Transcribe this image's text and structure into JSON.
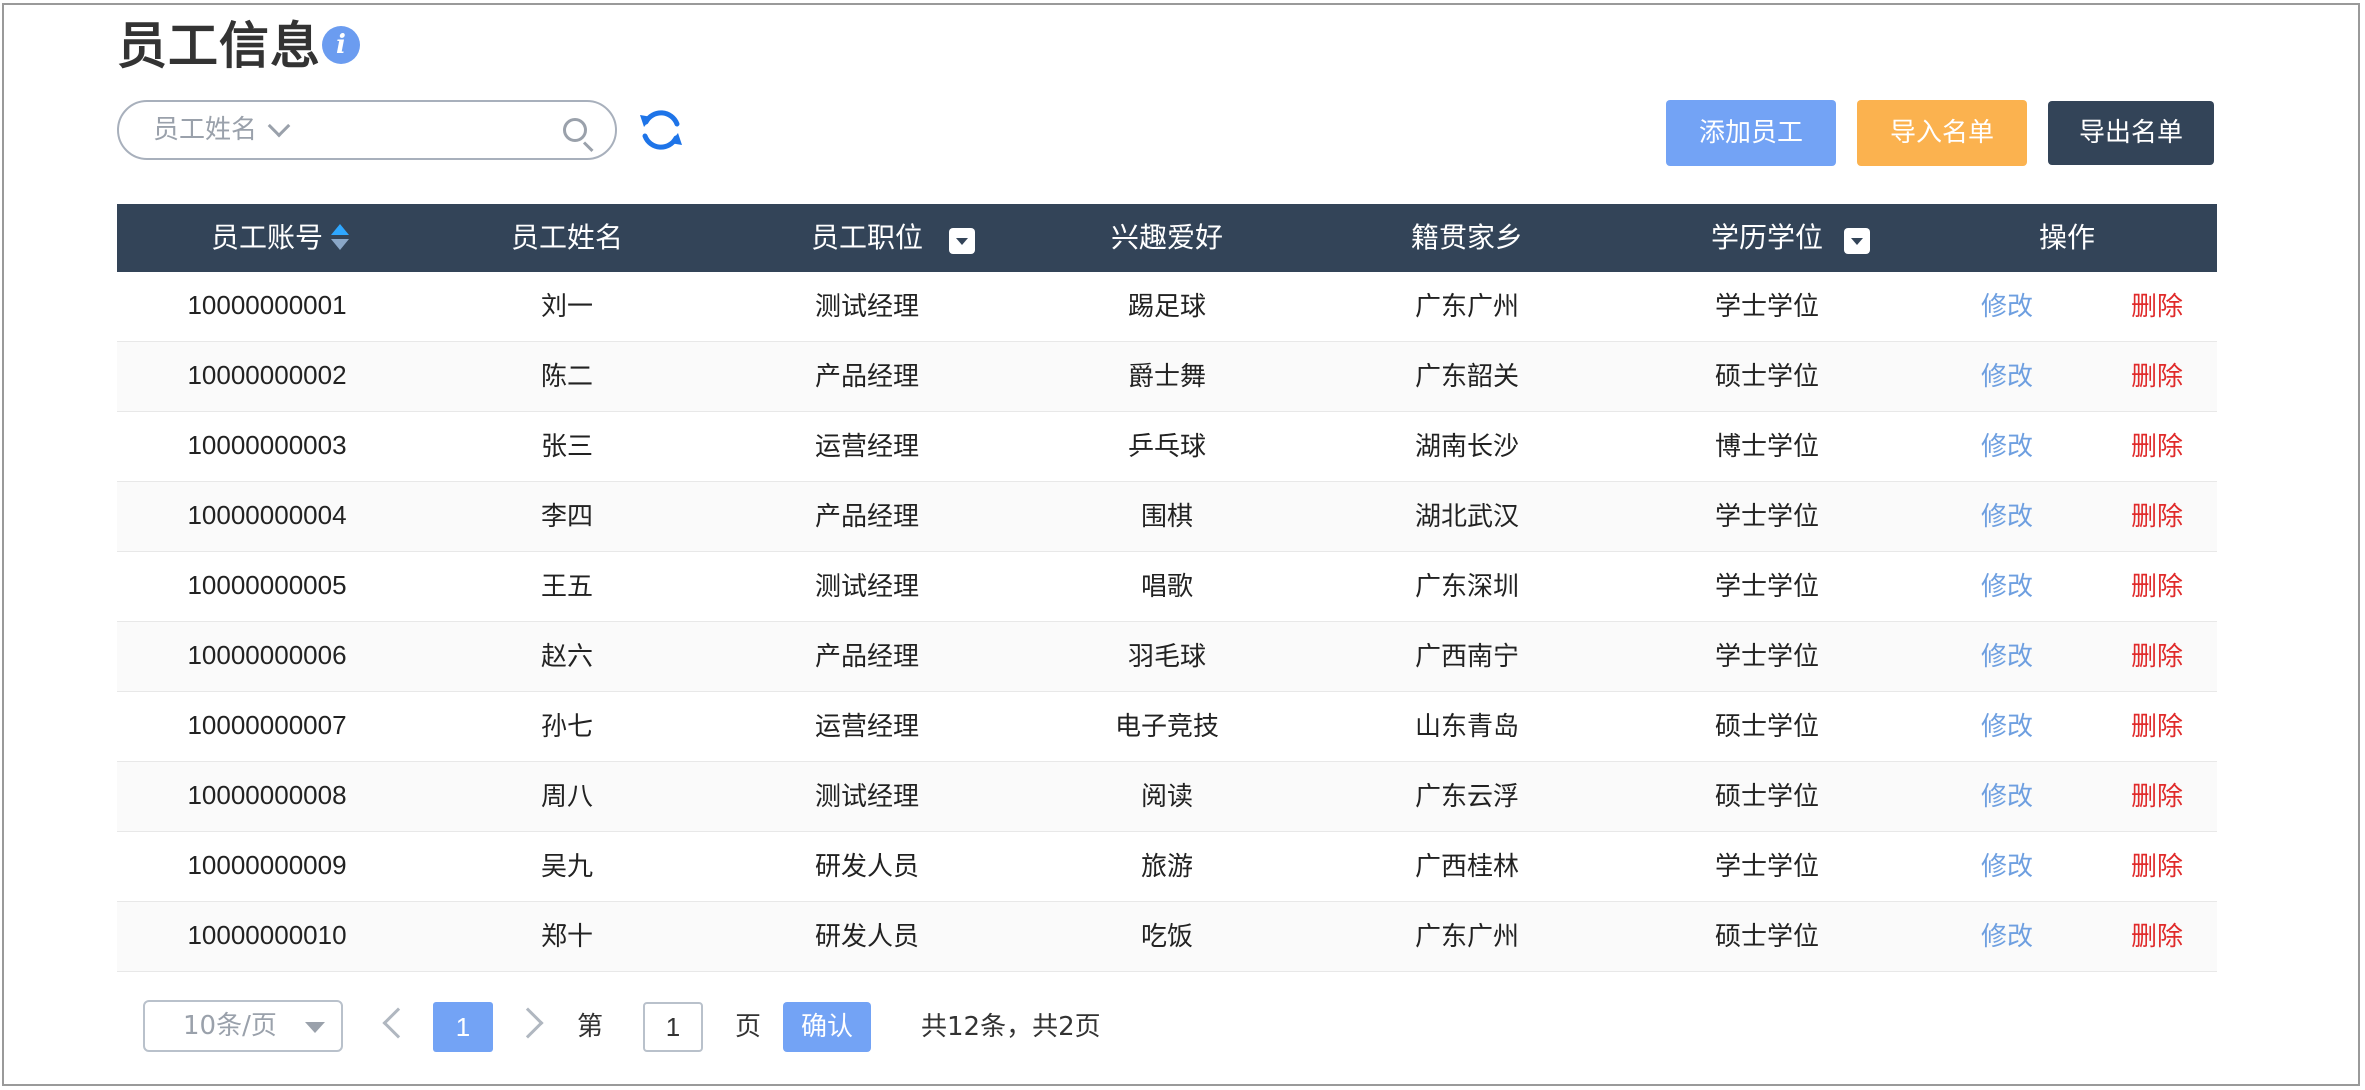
{
  "page": {
    "title": "员工信息",
    "info_icon": "info-icon"
  },
  "toolbar": {
    "search_field": "员工姓名",
    "search_placeholder": "",
    "search_icon": "search-icon",
    "refresh_icon": "refresh-icon",
    "add_label": "添加员工",
    "import_label": "导入名单",
    "export_label": "导出名单"
  },
  "colors": {
    "header_bg": "#334458",
    "primary": "#73a3f5",
    "warning": "#fbb24f",
    "danger": "#e02a2a",
    "link": "#6e9fe0"
  },
  "table": {
    "headers": {
      "account": "员工账号",
      "name": "员工姓名",
      "position": "员工职位",
      "hobby": "兴趣爱好",
      "hometown": "籍贯家乡",
      "degree": "学历学位",
      "action": "操作"
    },
    "edit_label": "修改",
    "delete_label": "删除",
    "rows": [
      {
        "account": "10000000001",
        "name": "刘一",
        "position": "测试经理",
        "hobby": "踢足球",
        "hometown": "广东广州",
        "degree": "学士学位"
      },
      {
        "account": "10000000002",
        "name": "陈二",
        "position": "产品经理",
        "hobby": "爵士舞",
        "hometown": "广东韶关",
        "degree": "硕士学位"
      },
      {
        "account": "10000000003",
        "name": "张三",
        "position": "运营经理",
        "hobby": "乒乓球",
        "hometown": "湖南长沙",
        "degree": "博士学位"
      },
      {
        "account": "10000000004",
        "name": "李四",
        "position": "产品经理",
        "hobby": "围棋",
        "hometown": "湖北武汉",
        "degree": "学士学位"
      },
      {
        "account": "10000000005",
        "name": "王五",
        "position": "测试经理",
        "hobby": "唱歌",
        "hometown": "广东深圳",
        "degree": "学士学位"
      },
      {
        "account": "10000000006",
        "name": "赵六",
        "position": "产品经理",
        "hobby": "羽毛球",
        "hometown": "广西南宁",
        "degree": "学士学位"
      },
      {
        "account": "10000000007",
        "name": "孙七",
        "position": "运营经理",
        "hobby": "电子竞技",
        "hometown": "山东青岛",
        "degree": "硕士学位"
      },
      {
        "account": "10000000008",
        "name": "周八",
        "position": "测试经理",
        "hobby": "阅读",
        "hometown": "广东云浮",
        "degree": "硕士学位"
      },
      {
        "account": "10000000009",
        "name": "吴九",
        "position": "研发人员",
        "hobby": "旅游",
        "hometown": "广西桂林",
        "degree": "学士学位"
      },
      {
        "account": "10000000010",
        "name": "郑十",
        "position": "研发人员",
        "hobby": "吃饭",
        "hometown": "广东广州",
        "degree": "硕士学位"
      }
    ]
  },
  "pagination": {
    "page_size": "10条/页",
    "current_page": "1",
    "goto_prefix": "第",
    "goto_value": "1",
    "goto_suffix": "页",
    "confirm_label": "确认",
    "summary": "共12条，共2页"
  }
}
